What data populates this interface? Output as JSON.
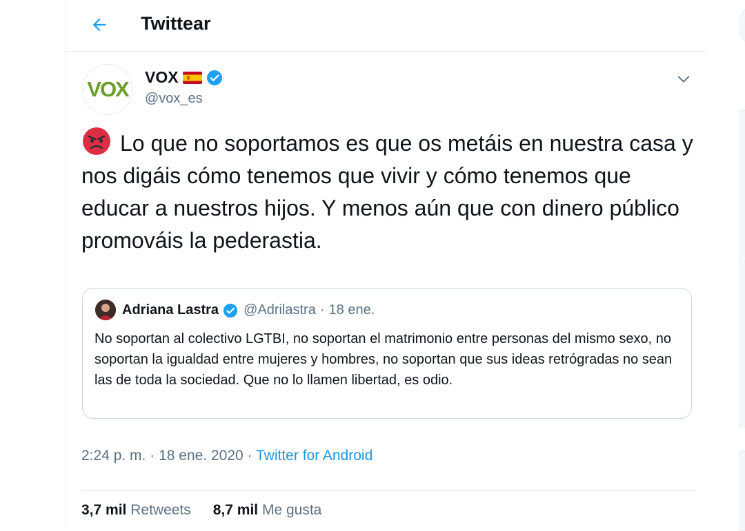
{
  "header": {
    "title": "Twittear",
    "back_icon": "arrow-left-icon"
  },
  "tweet": {
    "author": {
      "display_name": "VOX",
      "handle": "@vox_es",
      "avatar_text": "VOX",
      "verified": true
    },
    "text": "Lo que no soportamos es que os metáis en nuestra casa y nos digáis cómo tenemos que vivir y cómo tenemos que educar a nuestros hijos. Y menos aún que con dinero público promováis la pederastia.",
    "emoji": "angry-face-icon",
    "quoted": {
      "display_name": "Adriana Lastra",
      "handle": "@Adrilastra",
      "separator": "·",
      "date": "18 ene.",
      "text": "No soportan al colectivo LGTBI, no soportan el matrimonio entre personas del mismo sexo, no soportan la igualdad entre mujeres y hombres, no soportan que sus ideas retrógradas no sean las de toda la sociedad. Que no lo llamen libertad, es odio."
    },
    "time": "2:24 p. m.",
    "separator": "·",
    "date": "18 ene. 2020",
    "source": "Twitter for Android",
    "stats": {
      "retweets_count": "3,7 mil",
      "retweets_label": "Retweets",
      "likes_count": "8,7 mil",
      "likes_label": "Me gusta"
    }
  },
  "colors": {
    "accent": "#1da1f2",
    "link": "#1b95e0",
    "muted": "#5b7083",
    "vox_green": "#6a9f2c",
    "border": "#e6ecf0"
  }
}
